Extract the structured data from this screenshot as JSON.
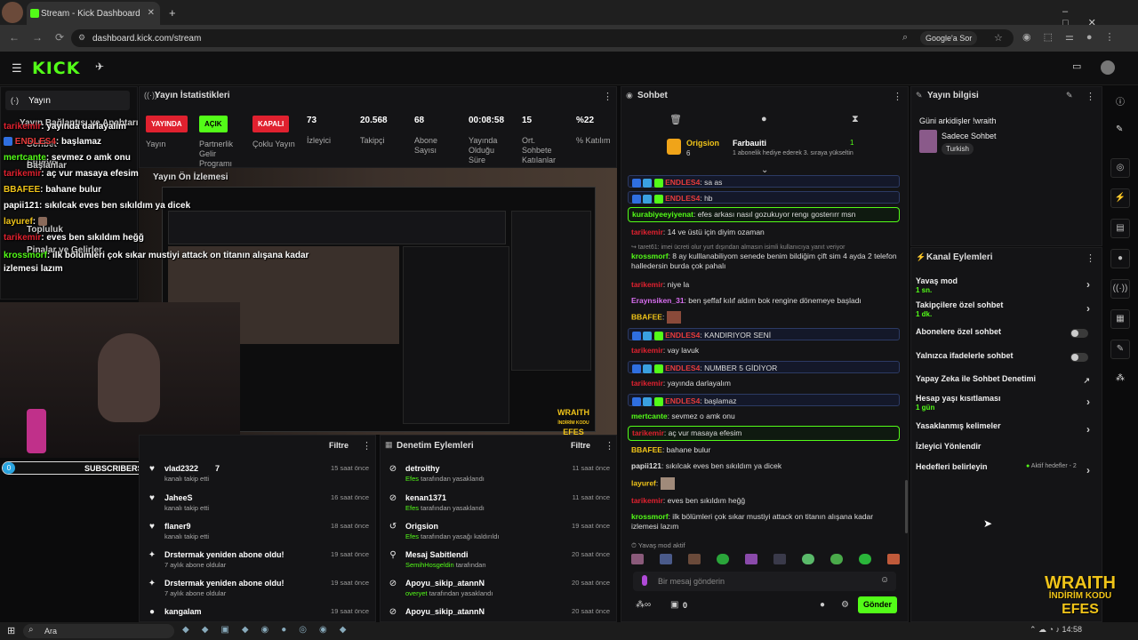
{
  "browser": {
    "tab_title": "Stream - Kick Dashboard",
    "url": "dashboard.kick.com/stream",
    "google_label": "Google'a Sor"
  },
  "nav": {
    "logo": "KICK"
  },
  "stats": {
    "title": "Yayın İstatistikleri",
    "badges": [
      {
        "text": "YAYINDA",
        "label": "Yayın",
        "color": "#e0212f"
      },
      {
        "text": "AÇIK",
        "label": "Partnerlik Gelir Programı",
        "color": "#53fc18"
      },
      {
        "text": "KAPALI",
        "label": "Çoklu Yayın",
        "color": "#e0212f"
      }
    ],
    "items": [
      {
        "value": "73",
        "label": "İzleyici"
      },
      {
        "value": "20.568",
        "label": "Takipçi"
      },
      {
        "value": "68",
        "label": "Abone Sayısı"
      },
      {
        "value": "00:08:58",
        "label": "Yayında Olduğu Süre"
      },
      {
        "value": "15",
        "label": "Ort. Sohbete Katılanlar"
      },
      {
        "value": "%22",
        "label": "% Katılım"
      }
    ]
  },
  "preview": {
    "title": "Yayın Ön İzlemesi",
    "watermark": "WRAITH",
    "watermark2": "İNDİRİM KODU",
    "watermark3": "EFES"
  },
  "overlay": {
    "lines": [
      {
        "user": "tarikemir",
        "text": ": yayında darlayalım"
      },
      {
        "user": "ENDLES4",
        "text": ": başlamaz"
      },
      {
        "user": "mertcante",
        "text": ": sevmez o amk onu"
      },
      {
        "user": "tarikemir",
        "text": ": aç vur masaya efesim"
      },
      {
        "user": "BBAFEE",
        "text": ": bahane bulur"
      },
      {
        "user": "papii121",
        "text": ": sıkılcak eves ben sıkıldım ya dicek"
      },
      {
        "user": "layuref",
        "text": ":"
      },
      {
        "user": "tarikemir",
        "text": ": eves ben sıkıldım heğğ"
      },
      {
        "user": "krossmorf",
        "text": ": ilk bölümleri çok sıkar mustiyi attack on titanın alışana kadar izlemesi lazım"
      }
    ],
    "menu": [
      "Yayın",
      "Yayın Bağlantısı ve Anahtarı",
      "Sohbet",
      "Stüdyo",
      "Başlanlar",
      "Topluluk",
      "Pinalar ve Gelirler"
    ],
    "subs_label": "SUBSCRIBERS",
    "subs_count": "0"
  },
  "activity": {
    "filter": "Filtre",
    "items": [
      {
        "name": "vlad2322",
        "sub": "kanalı takip etti",
        "time": "15 saat önce",
        "count": "7",
        "icon": "heart"
      },
      {
        "name": "JaheeS",
        "sub": "kanalı takip etti",
        "time": "16 saat önce",
        "icon": "heart"
      },
      {
        "name": "flaner9",
        "sub": "kanalı takip etti",
        "time": "18 saat önce",
        "icon": "heart"
      },
      {
        "name": "Drstermak yeniden abone oldu!",
        "sub": "7 aylık abone oldular",
        "time": "19 saat önce",
        "icon": "star"
      },
      {
        "name": "Drstermak yeniden abone oldu!",
        "sub": "7 aylık abone oldular",
        "time": "19 saat önce",
        "icon": "star"
      },
      {
        "name": "kangalam",
        "sub": "",
        "time": "19 saat önce",
        "icon": "dot"
      }
    ]
  },
  "moderation": {
    "title": "Denetim Eylemleri",
    "filter": "Filtre",
    "items": [
      {
        "name": "detroithy",
        "sub_a": "Efes",
        "sub_b": "tarafından yasaklandı",
        "time": "11 saat önce",
        "icon": "ban"
      },
      {
        "name": "kenan1371",
        "sub_a": "Efes",
        "sub_b": "tarafından yasaklandı",
        "time": "11 saat önce",
        "icon": "ban"
      },
      {
        "name": "Origsion",
        "sub_a": "Efes",
        "sub_b": "tarafından yasağı kaldırıldı",
        "time": "19 saat önce",
        "icon": "undo"
      },
      {
        "name": "Mesaj Sabitlendi",
        "sub_a": "SemihHosgeldin",
        "sub_b": "tarafından",
        "time": "20 saat önce",
        "icon": "pin"
      },
      {
        "name": "Apoyu_sikip_atannN",
        "sub_a": "overyet",
        "sub_b": "tarafından yasaklandı",
        "time": "20 saat önce",
        "icon": "ban"
      },
      {
        "name": "Apoyu_sikip_atannN",
        "sub_a": "",
        "sub_b": "",
        "time": "20 saat önce",
        "icon": "ban"
      }
    ]
  },
  "chat": {
    "title": "Sohbet",
    "pinned": {
      "user1": "Origsion",
      "num1": "6",
      "user2": "Farbauiti",
      "num2": "1",
      "gift_text": "1 abonelik hediye ederek 3. sıraya yükseltin"
    },
    "messages": [
      {
        "user": "ENDLES4",
        "text": ": sa as",
        "style": "blue",
        "badges": true,
        "color": "#e83b3b"
      },
      {
        "user": "ENDLES4",
        "text": ": hb",
        "style": "blue",
        "badges": true,
        "color": "#e83b3b"
      },
      {
        "user": "kurabiyeeyiyenat",
        "text": ": efes arkası nasıl gozukuyor rengı gosterırr msn",
        "style": "green",
        "color": "#53fc18"
      },
      {
        "user": "tarikemir",
        "text": ": 14 ve üstü için diyim ozaman",
        "style": "",
        "color": "#e0212f"
      },
      {
        "user": "",
        "text": "↪ taret61: imei ücreti olur yurt dışından almasın isimli kullanıcıya yanıt veriyor",
        "style": "reply",
        "color": "#888"
      },
      {
        "user": "krossmorf",
        "text": ": 8 ay kulllanabiliyom senede benim bildiğim çift sim 4 ayda 2 telefon halledersin burda çok pahalı",
        "style": "",
        "color": "#53fc18"
      },
      {
        "user": "tarikemir",
        "text": ": niye la",
        "style": "",
        "color": "#e0212f"
      },
      {
        "user": "Eraynsiken_31",
        "text": ": ben şeffaf kılıf aldım bok rengine dönemeye başladı",
        "style": "",
        "color": "#d86ef0"
      },
      {
        "user": "BBAFEE",
        "text": ":",
        "style": "emote",
        "color": "#f0c419"
      },
      {
        "user": "ENDLES4",
        "text": ": KANDIRIYOR SENİ",
        "style": "blue",
        "badges": true,
        "color": "#e83b3b"
      },
      {
        "user": "tarikemir",
        "text": ": vay lavuk",
        "style": "",
        "color": "#e0212f"
      },
      {
        "user": "ENDLES4",
        "text": ": NUMBER 5 GİDİYOR",
        "style": "blue",
        "badges": true,
        "color": "#e83b3b"
      },
      {
        "user": "tarikemir",
        "text": ": yayında darlayalım",
        "style": "",
        "color": "#e0212f"
      },
      {
        "user": "ENDLES4",
        "text": ": başlamaz",
        "style": "blue",
        "badges": true,
        "color": "#e83b3b"
      },
      {
        "user": "mertcante",
        "text": ": sevmez o amk onu",
        "style": "",
        "color": "#53fc18"
      },
      {
        "user": "tarikemir",
        "text": ": aç vur masaya efesim",
        "style": "green",
        "color": "#e0212f"
      },
      {
        "user": "BBAFEE",
        "text": ": bahane bulur",
        "style": "",
        "color": "#f0c419"
      },
      {
        "user": "papii121",
        "text": ": sıkılcak eves ben sıkıldım ya dicek",
        "style": "",
        "color": "#e6e6e6"
      },
      {
        "user": "layuref",
        "text": ":",
        "style": "emote",
        "color": "#f0c419"
      },
      {
        "user": "tarikemir",
        "text": ": eves ben sıkıldım heğğ",
        "style": "",
        "color": "#e0212f"
      },
      {
        "user": "krossmorf",
        "text": ": ilk bölümleri çok sıkar mustiyi attack on titanın alışana kadar izlemesi lazım",
        "style": "",
        "color": "#53fc18"
      }
    ],
    "slow_mode": "Yavaş mod aktif",
    "input_placeholder": "Bir mesaj gönderin",
    "send": "Gönder",
    "count": "0"
  },
  "info": {
    "title": "Yayın bilgisi",
    "stream_title": "Güni arkidişler !wraith",
    "category": "Sadece Sohbet",
    "language": "Turkish"
  },
  "actions": {
    "title": "Kanal Eylemleri",
    "items": [
      {
        "label": "Yavaş mod",
        "sub": "1 sn.",
        "type": "chev"
      },
      {
        "label": "Takipçilere özel sohbet",
        "sub": "1 dk.",
        "type": "chev"
      },
      {
        "label": "Abonelere özel sohbet",
        "sub": "",
        "type": "toggle"
      },
      {
        "label": "Yalnızca ifadelerle sohbet",
        "sub": "",
        "type": "toggle"
      },
      {
        "label": "Yapay Zeka ile Sohbet Denetimi",
        "sub": "",
        "type": "ext"
      },
      {
        "label": "Hesap yaşı kısıtlaması",
        "sub": "1 gün",
        "type": "chev"
      },
      {
        "label": "Yasaklanmış kelimeler",
        "sub": "",
        "type": "chev"
      },
      {
        "label": "İzleyici Yönlendir",
        "sub": "",
        "type": "none"
      },
      {
        "label": "Hedefleri belirleyin",
        "sub": "",
        "type": "goal",
        "extra": "Aktif hedefler - 2"
      }
    ]
  },
  "brand": {
    "line1": "WRAITH",
    "line2": "İNDİRİM KODU",
    "line3": "EFES"
  },
  "taskbar": {
    "search": "Ara",
    "clock": "14:58"
  },
  "colors": {
    "accent": "#53fc18",
    "live": "#e0212f",
    "panel": "#141416"
  }
}
